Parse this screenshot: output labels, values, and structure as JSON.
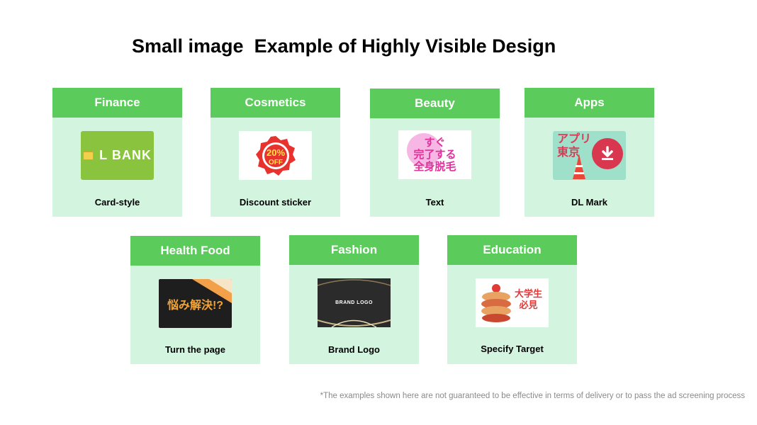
{
  "title": "Small image  Example of Highly Visible Design",
  "categories": [
    {
      "category": "Finance",
      "label": "Card-style",
      "thumb_text": "L BANK"
    },
    {
      "category": "Cosmetics",
      "label": "Discount sticker",
      "thumb_text": "20%\nOFF"
    },
    {
      "category": "Beauty",
      "label": "Text",
      "thumb_text": "すぐ\n完了する\n全身脱毛"
    },
    {
      "category": "Apps",
      "label": "DL Mark",
      "thumb_text": "アプリ\n東京"
    },
    {
      "category": "Health Food",
      "label": "Turn the page",
      "thumb_text": "悩み解決!?"
    },
    {
      "category": "Fashion",
      "label": "Brand Logo",
      "thumb_text": "BRAND LOGO"
    },
    {
      "category": "Education",
      "label": "Specify Target",
      "thumb_text": "大学生\n必見"
    }
  ],
  "footnote": "*The examples shown here are not guaranteed to be effective in terms of delivery or to pass the ad screening process",
  "colors": {
    "header_green": "#5bcb5b",
    "card_bg": "#d3f5e0"
  }
}
